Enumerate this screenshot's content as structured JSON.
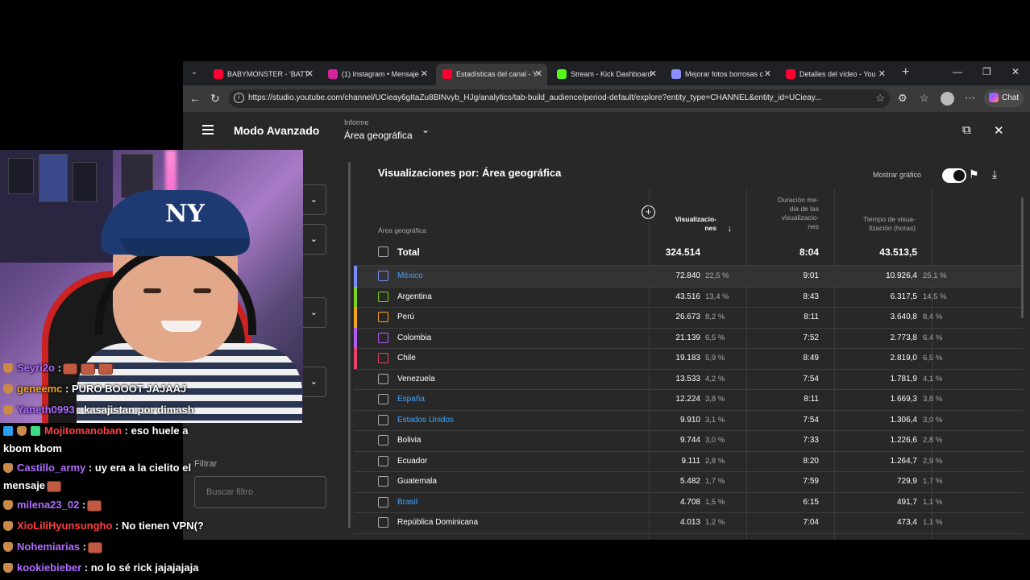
{
  "browser": {
    "tabs": [
      {
        "title": "BABYMONSTER - 'BATTI",
        "favicon_color": "#ff0033",
        "active": false
      },
      {
        "title": "(1) Instagram • Mensaje",
        "favicon_color": "#d6249f",
        "active": false
      },
      {
        "title": "Estadísticas del canal - Y",
        "favicon_color": "#ff0033",
        "active": true
      },
      {
        "title": "Stream - Kick Dashboard",
        "favicon_color": "#53fc18",
        "active": false
      },
      {
        "title": "Mejorar fotos borrosas c",
        "favicon_color": "#8a8fff",
        "active": false
      },
      {
        "title": "Detalles del vídeo - You",
        "favicon_color": "#ff0033",
        "active": false
      }
    ],
    "url": "https://studio.youtube.com/channel/UCieay6gItaZu8BINvyb_HJg/analytics/tab-build_audience/period-default/explore?entity_type=CHANNEL&entity_id=UCieay...",
    "chat_label": "Chat"
  },
  "studio": {
    "mode_title": "Modo Avanzado",
    "report_label": "Informe",
    "report_value": "Área geográfica",
    "filter_label": "Filtrar",
    "search_placeholder": "Buscar filtro"
  },
  "table": {
    "title": "Visualizaciones por: Área geográfica",
    "show_chart_label": "Mostrar gráfico",
    "col_area": "Área geográfica",
    "col_views": [
      "Visualizacio-",
      "nes"
    ],
    "col_avg_duration": [
      "Duración me-",
      "dia de las",
      "visualizacio-",
      "nes"
    ],
    "col_watch_time": [
      "Tiempo de visua-",
      "lización (horas)"
    ],
    "total": {
      "name": "Total",
      "views": "324.514",
      "avg": "8:04",
      "hours": "43.513,5"
    },
    "rows": [
      {
        "name": "México",
        "views": "72.840",
        "views_pct": "22,5 %",
        "avg": "9:01",
        "hours": "10.926,4",
        "hours_pct": "25,1 %",
        "color": "#7a8cff",
        "link": true
      },
      {
        "name": "Argentina",
        "views": "43.516",
        "views_pct": "13,4 %",
        "avg": "8:43",
        "hours": "6.317,5",
        "hours_pct": "14,5 %",
        "color": "#7ed321",
        "link": false
      },
      {
        "name": "Perú",
        "views": "26.673",
        "views_pct": "8,2 %",
        "avg": "8:11",
        "hours": "3.640,8",
        "hours_pct": "8,4 %",
        "color": "#f5a623",
        "link": false
      },
      {
        "name": "Colombia",
        "views": "21.139",
        "views_pct": "6,5 %",
        "avg": "7:52",
        "hours": "2.773,8",
        "hours_pct": "6,4 %",
        "color": "#b25cf0",
        "link": false
      },
      {
        "name": "Chile",
        "views": "19.183",
        "views_pct": "5,9 %",
        "avg": "8:49",
        "hours": "2.819,0",
        "hours_pct": "6,5 %",
        "color": "#e8446a",
        "link": false
      },
      {
        "name": "Venezuela",
        "views": "13.533",
        "views_pct": "4,2 %",
        "avg": "7:54",
        "hours": "1.781,9",
        "hours_pct": "4,1 %",
        "color": "",
        "link": false
      },
      {
        "name": "España",
        "views": "12.224",
        "views_pct": "3,8 %",
        "avg": "8:11",
        "hours": "1.669,3",
        "hours_pct": "3,8 %",
        "color": "",
        "link": true
      },
      {
        "name": "Estados Unidos",
        "views": "9.910",
        "views_pct": "3,1 %",
        "avg": "7:54",
        "hours": "1.306,4",
        "hours_pct": "3,0 %",
        "color": "",
        "link": true
      },
      {
        "name": "Bolivia",
        "views": "9.744",
        "views_pct": "3,0 %",
        "avg": "7:33",
        "hours": "1.226,6",
        "hours_pct": "2,8 %",
        "color": "",
        "link": false
      },
      {
        "name": "Ecuador",
        "views": "9.111",
        "views_pct": "2,8 %",
        "avg": "8:20",
        "hours": "1.264,7",
        "hours_pct": "2,9 %",
        "color": "",
        "link": false
      },
      {
        "name": "Guatemala",
        "views": "5.482",
        "views_pct": "1,7 %",
        "avg": "7:59",
        "hours": "729,9",
        "hours_pct": "1,7 %",
        "color": "",
        "link": false
      },
      {
        "name": "Brasil",
        "views": "4.708",
        "views_pct": "1,5 %",
        "avg": "6:15",
        "hours": "491,7",
        "hours_pct": "1,1 %",
        "color": "",
        "link": true
      },
      {
        "name": "República Dominicana",
        "views": "4.013",
        "views_pct": "1,2 %",
        "avg": "7:04",
        "hours": "473,4",
        "hours_pct": "1,1 %",
        "color": "",
        "link": false
      }
    ]
  },
  "chat": [
    {
      "user": "Seyri2o",
      "color": "#b06cff",
      "text": ":",
      "emotes": 3,
      "badges": [
        "bull"
      ]
    },
    {
      "user": "geneemc",
      "color": "#f5a623",
      "text": ": PURO BOOOT JAJAAJ",
      "emotes": 0,
      "badges": [
        "bull"
      ]
    },
    {
      "user": "Yaneth0993",
      "color": "#b06cff",
      "text": ": kasajistan por dimash",
      "emotes": 0,
      "badges": [
        "bull"
      ]
    },
    {
      "user": "Mojitomanoban",
      "color": "#ff4040",
      "text": ": eso huele a kbom kbom",
      "emotes": 0,
      "badges": [
        "vip",
        "bull",
        "gift"
      ]
    },
    {
      "user": "Castillo_army",
      "color": "#b06cff",
      "text": ": uy era a la cielito el mensaje",
      "emotes": 1,
      "badges": [
        "bull"
      ]
    },
    {
      "user": "milena23_02",
      "color": "#b06cff",
      "text": ":",
      "emotes": 1,
      "badges": [
        "bull"
      ]
    },
    {
      "user": "XioLiliHyunsungho",
      "color": "#ff4040",
      "text": ": No tienen VPN(?",
      "emotes": 0,
      "badges": [
        "bull"
      ]
    },
    {
      "user": "Nohemiarias",
      "color": "#b06cff",
      "text": ":",
      "emotes": 1,
      "badges": [
        "bull"
      ]
    },
    {
      "user": "kookiebieber",
      "color": "#b06cff",
      "text": ": no lo sé rick jajajajaja",
      "emotes": 0,
      "badges": [
        "bull"
      ]
    }
  ]
}
